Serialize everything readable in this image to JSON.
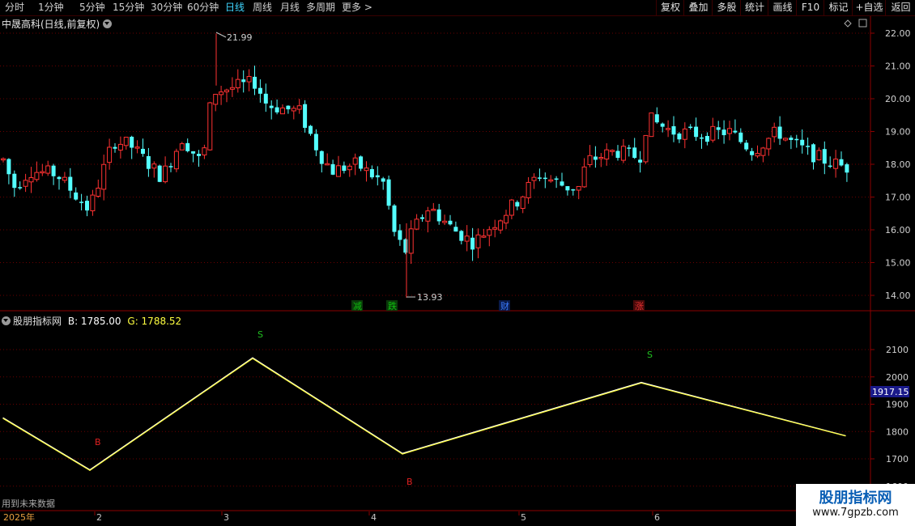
{
  "toolbar": {
    "periods": [
      "分时",
      "1分钟",
      "5分钟",
      "15分钟",
      "30分钟",
      "60分钟",
      "日线",
      "周线",
      "月线",
      "多周期",
      "更多"
    ],
    "more_arrow": ">",
    "active_period": "日线",
    "right_buttons": [
      "复权",
      "叠加",
      "多股",
      "统计",
      "画线",
      "F10",
      "标记",
      "+自选",
      "返回"
    ]
  },
  "main_chart": {
    "title": "中晟高科(日线,前复权)",
    "high_label": "21.99",
    "low_label": "13.93",
    "price_ticks": [
      "22.00",
      "21.00",
      "20.00",
      "19.00",
      "18.00",
      "17.00",
      "16.00",
      "15.00",
      "14.00"
    ],
    "event_markers": [
      {
        "text": "减",
        "color": "#0fbf0f"
      },
      {
        "text": "跌",
        "color": "#0fbf0f"
      },
      {
        "text": "财",
        "color": "#2e6bff"
      },
      {
        "text": "涨",
        "color": "#d02020"
      }
    ]
  },
  "indicator": {
    "name": "股朋指标网",
    "b_label": "B: 1785.00",
    "g_label": "G: 1788.52",
    "ticks": [
      "2100",
      "2000",
      "1900",
      "1800",
      "1700",
      "1600"
    ],
    "current_value": "1917.15",
    "signals": [
      {
        "text": "B",
        "color": "#e02020"
      },
      {
        "text": "S",
        "color": "#20c020"
      },
      {
        "text": "B",
        "color": "#e02020"
      },
      {
        "text": "S",
        "color": "#20c020"
      }
    ],
    "chart_data": {
      "type": "line",
      "series": [
        {
          "name": "B",
          "values": [
            1850,
            1660,
            2070,
            1720,
            1980,
            1785
          ]
        },
        {
          "name": "G",
          "values": [
            1852,
            1662,
            2072,
            1722,
            1982,
            1788.52
          ]
        }
      ],
      "ylim": [
        1600,
        2200
      ]
    }
  },
  "time_axis": {
    "labels": [
      "2025年",
      "2",
      "3",
      "4",
      "5",
      "6"
    ]
  },
  "note": "用到未来数据",
  "watermark": {
    "title": "股朋指标网",
    "url": "www.7gpzb.com"
  },
  "colors": {
    "up": "#ff3232",
    "down": "#54ffff",
    "line_b": "#ffffff",
    "line_g": "#ffff40",
    "grid": "#6a0000",
    "frame": "#8b0000"
  }
}
